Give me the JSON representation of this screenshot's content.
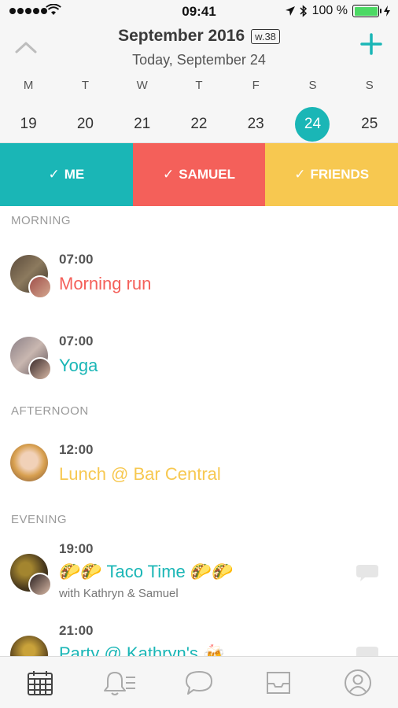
{
  "status_bar": {
    "time": "09:41",
    "battery": "100 %"
  },
  "header": {
    "month_title": "September 2016",
    "week_badge": "w.38",
    "today_label": "Today, September 24"
  },
  "week": [
    {
      "letter": "M",
      "num": "19",
      "selected": false
    },
    {
      "letter": "T",
      "num": "20",
      "selected": false
    },
    {
      "letter": "W",
      "num": "21",
      "selected": false
    },
    {
      "letter": "T",
      "num": "22",
      "selected": false
    },
    {
      "letter": "F",
      "num": "23",
      "selected": false
    },
    {
      "letter": "S",
      "num": "24",
      "selected": true
    },
    {
      "letter": "S",
      "num": "25",
      "selected": false
    }
  ],
  "filters": {
    "me": "ME",
    "samuel": "SAMUEL",
    "friends": "FRIENDS",
    "check": "✓"
  },
  "sections": {
    "morning": "MORNING",
    "afternoon": "AFTERNOON",
    "evening": "EVENING"
  },
  "events": [
    {
      "time": "07:00",
      "title": "Morning run",
      "color": "#f4605a"
    },
    {
      "time": "07:00",
      "title": "Yoga",
      "color": "#1ab6b6"
    },
    {
      "time": "12:00",
      "title": "Lunch @ Bar Central",
      "color": "#f7c850"
    },
    {
      "time": "19:00",
      "title": "🌮🌮 Taco Time 🌮🌮",
      "subtitle": "with Kathryn & Samuel",
      "color": "#1ab6b6"
    },
    {
      "time": "21:00",
      "title": "Party @ Kathryn's 🍻",
      "color": "#1ab6b6"
    }
  ],
  "colors": {
    "teal": "#1ab6b6",
    "coral": "#f4605a",
    "yellow": "#f7c850"
  },
  "tabs": [
    "calendar-icon",
    "notifications-icon",
    "chat-icon",
    "inbox-icon",
    "profile-icon"
  ]
}
